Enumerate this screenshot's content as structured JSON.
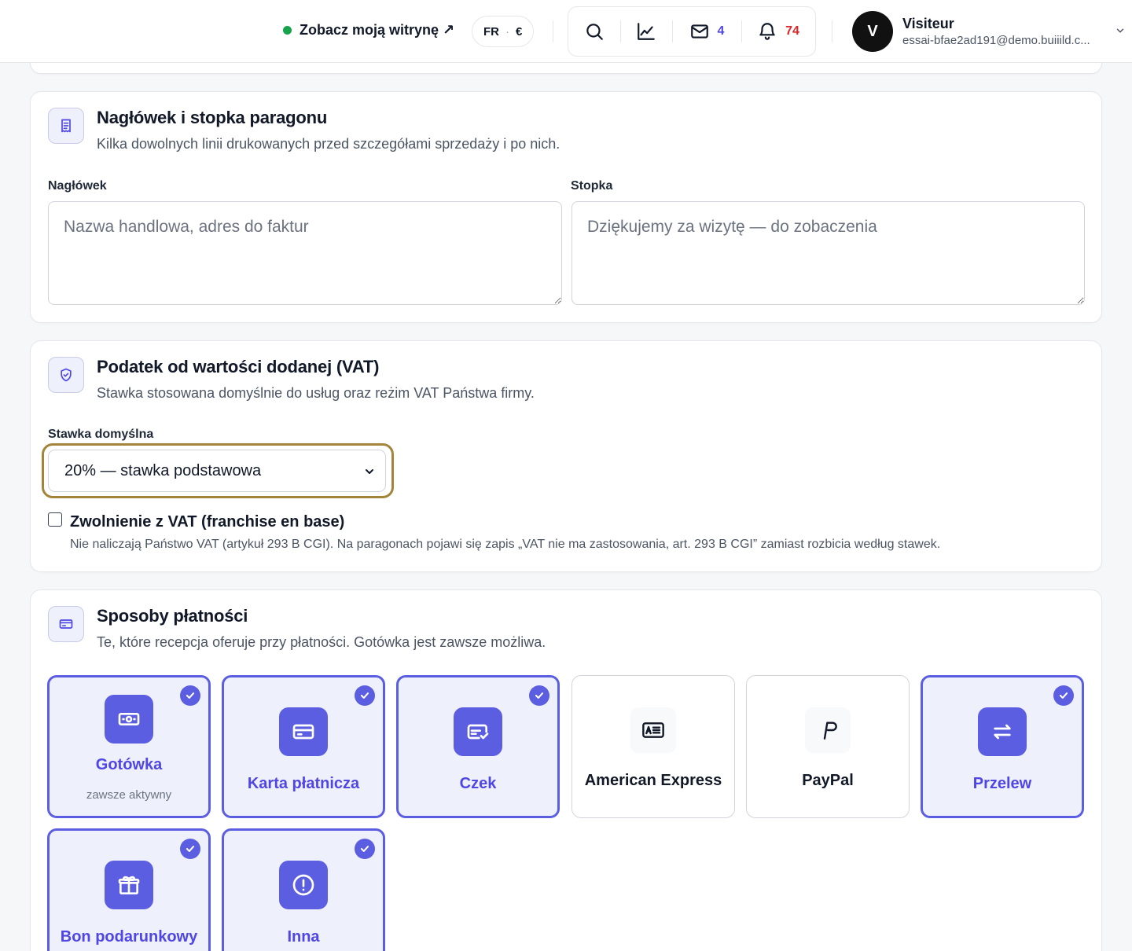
{
  "header": {
    "site_link": "Zobacz moją witrynę ↗",
    "locale": "FR",
    "currency": "€",
    "messages_count": "4",
    "notifications_count": "74",
    "user": {
      "initial": "V",
      "name": "Visiteur",
      "email": "essai-bfae2ad191@demo.buiiild.c..."
    }
  },
  "receipt": {
    "title": "Nagłówek i stopka paragonu",
    "subtitle": "Kilka dowolnych linii drukowanych przed szczegółami sprzedaży i po nich.",
    "header_label": "Nagłówek",
    "header_placeholder": "Nazwa handlowa, adres do faktur",
    "footer_label": "Stopka",
    "footer_placeholder": "Dziękujemy za wizytę — do zobaczenia"
  },
  "vat": {
    "title": "Podatek od wartości dodanej (VAT)",
    "subtitle": "Stawka stosowana domyślnie do usług oraz reżim VAT Państwa firmy.",
    "rate_label": "Stawka domyślna",
    "rate_value": "20% — stawka podstawowa",
    "exempt_label": "Zwolnienie z VAT (franchise en base)",
    "exempt_checked": false,
    "exempt_help": "Nie naliczają Państwo VAT (artykuł 293 B CGI). Na paragonach pojawi się zapis „VAT nie ma zastosowania, art. 293 B CGI” zamiast rozbicia według stawek."
  },
  "payments": {
    "title": "Sposoby płatności",
    "subtitle": "Te, które recepcja oferuje przy płatności. Gotówka jest zawsze możliwa.",
    "methods": [
      {
        "label": "Gotówka",
        "note": "zawsze aktywny",
        "enabled": true,
        "icon": "banknote-icon"
      },
      {
        "label": "Karta płatnicza",
        "enabled": true,
        "icon": "credit-card-icon"
      },
      {
        "label": "Czek",
        "enabled": true,
        "icon": "check-cheque-icon"
      },
      {
        "label": "American Express",
        "enabled": false,
        "icon": "amex-card-icon"
      },
      {
        "label": "PayPal",
        "enabled": false,
        "icon": "paypal-icon"
      },
      {
        "label": "Przelew",
        "enabled": true,
        "icon": "transfer-arrows-icon"
      },
      {
        "label": "Bon podarunkowy",
        "enabled": true,
        "icon": "gift-icon"
      },
      {
        "label": "Inna",
        "enabled": true,
        "icon": "alert-circle-icon"
      }
    ]
  },
  "colors": {
    "accent": "#5b5ee0",
    "accent_text": "#4f46e5",
    "focus_ring": "#a3843a",
    "online_dot": "#16a34a",
    "alert_count": "#dc2626"
  }
}
